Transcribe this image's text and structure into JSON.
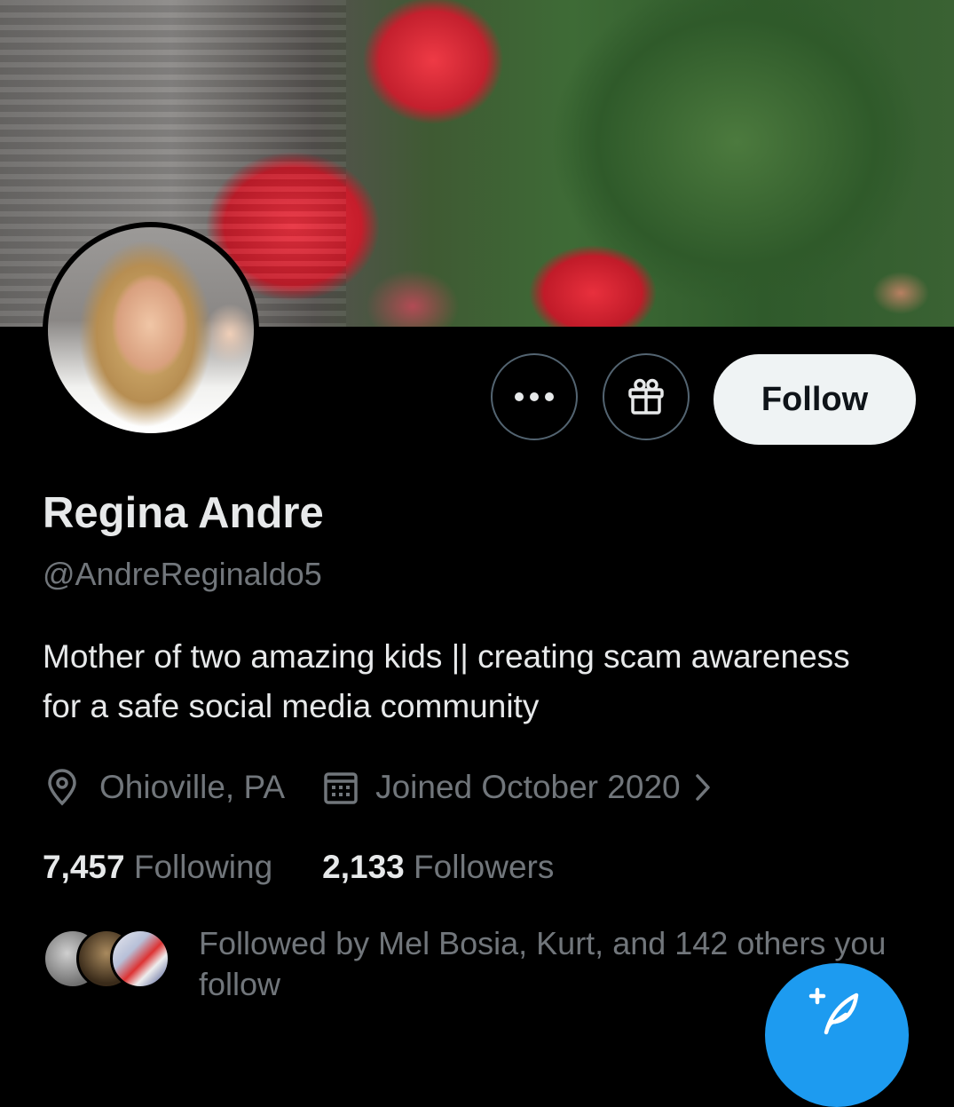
{
  "profile": {
    "display_name": "Regina Andre",
    "handle": "@AndreReginaldo5",
    "bio": "Mother of two amazing kids || creating scam awareness for a safe social media community",
    "location": "Ohioville, PA",
    "joined": "Joined October 2020",
    "following_count": "7,457",
    "following_label": "Following",
    "followers_count": "2,133",
    "followers_label": "Followers",
    "followed_by": "Followed by Mel Bosia, Kurt, and 142 others you follow"
  },
  "actions": {
    "follow_label": "Follow",
    "more_icon": "more-icon",
    "gift_icon": "gift-icon"
  },
  "icons": {
    "location": "location-pin-icon",
    "calendar": "calendar-icon",
    "chevron": "chevron-right-icon",
    "compose": "compose-post-icon"
  },
  "colors": {
    "background": "#000000",
    "primary_text": "#e7e9ea",
    "secondary_text": "#71767b",
    "accent": "#1d9bf0",
    "follow_button_bg": "#eff3f4"
  }
}
